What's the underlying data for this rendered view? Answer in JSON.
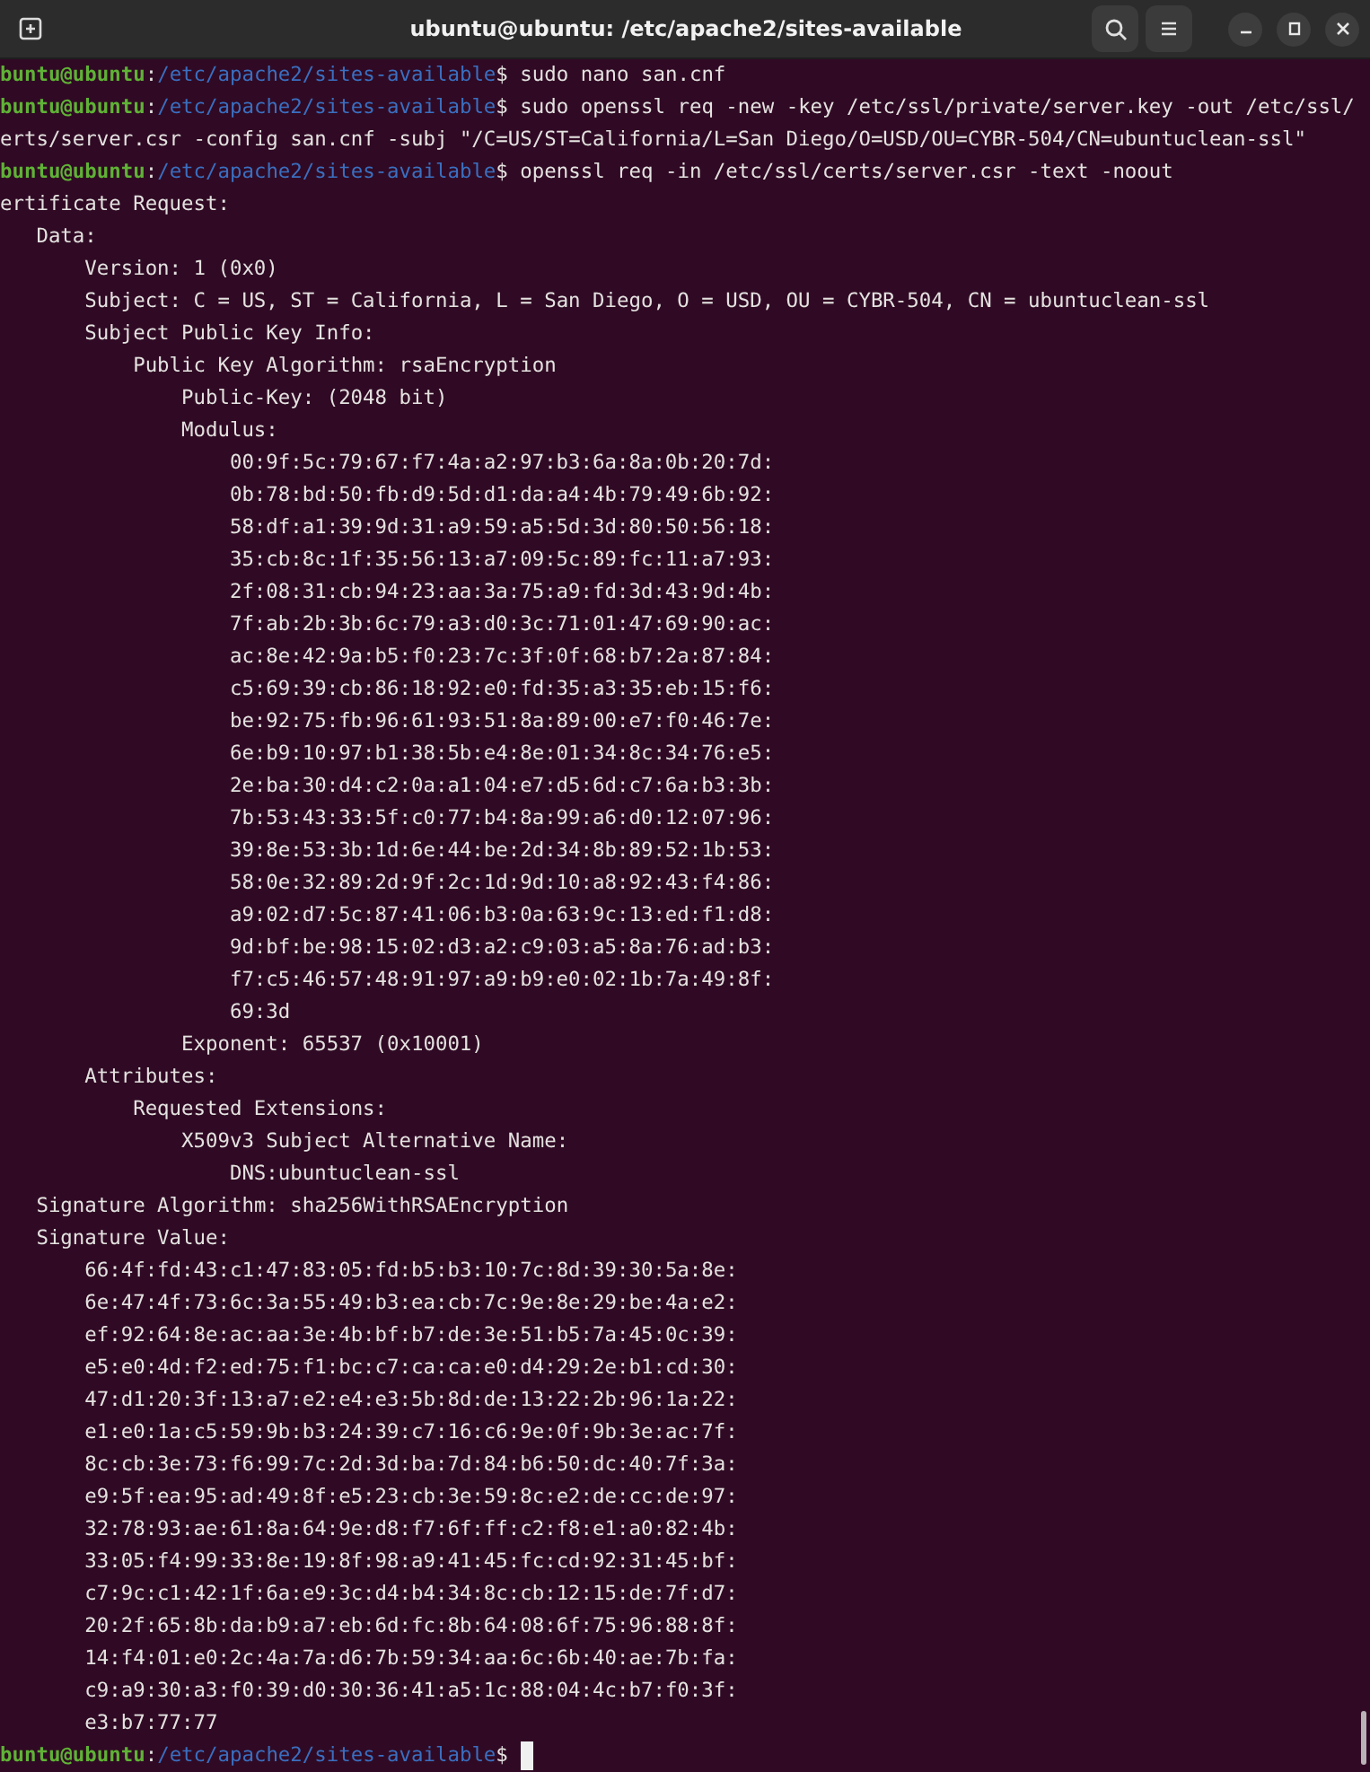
{
  "window": {
    "title": "ubuntu@ubuntu: /etc/apache2/sites-available"
  },
  "terminal": {
    "lines": [
      {
        "kind": "prompt",
        "user": "buntu@ubuntu",
        "separator": ":",
        "path": "/etc/apache2/sites-available",
        "symbol": "$",
        "command": "sudo nano san.cnf",
        "cursor": false
      },
      {
        "kind": "prompt",
        "user": "buntu@ubuntu",
        "separator": ":",
        "path": "/etc/apache2/sites-available",
        "symbol": "$",
        "command": "sudo openssl req -new -key /etc/ssl/private/server.key -out /etc/ssl/",
        "cursor": false
      },
      {
        "kind": "output",
        "text": "erts/server.csr -config san.cnf -subj \"/C=US/ST=California/L=San Diego/O=USD/OU=CYBR-504/CN=ubuntuclean-ssl\""
      },
      {
        "kind": "prompt",
        "user": "buntu@ubuntu",
        "separator": ":",
        "path": "/etc/apache2/sites-available",
        "symbol": "$",
        "command": "openssl req -in /etc/ssl/certs/server.csr -text -noout",
        "cursor": false
      },
      {
        "kind": "output",
        "text": "ertificate Request:",
        "children": [
          {
            "text": "Data:",
            "children": [
              {
                "text": "Version: 1 (0x0)"
              },
              {
                "text": "Subject: C = US, ST = California, L = San Diego, O = USD, OU = CYBR-504, CN = ubuntuclean-ssl"
              },
              {
                "text": "Subject Public Key Info:",
                "children": [
                  {
                    "text": "Public Key Algorithm: rsaEncryption",
                    "children": [
                      {
                        "text": "Public-Key: (2048 bit)"
                      },
                      {
                        "text": "Modulus:",
                        "children": [
                          {
                            "text": "00:9f:5c:79:67:f7:4a:a2:97:b3:6a:8a:0b:20:7d:"
                          },
                          {
                            "text": "0b:78:bd:50:fb:d9:5d:d1:da:a4:4b:79:49:6b:92:"
                          },
                          {
                            "text": "58:df:a1:39:9d:31:a9:59:a5:5d:3d:80:50:56:18:"
                          },
                          {
                            "text": "35:cb:8c:1f:35:56:13:a7:09:5c:89:fc:11:a7:93:"
                          },
                          {
                            "text": "2f:08:31:cb:94:23:aa:3a:75:a9:fd:3d:43:9d:4b:"
                          },
                          {
                            "text": "7f:ab:2b:3b:6c:79:a3:d0:3c:71:01:47:69:90:ac:"
                          },
                          {
                            "text": "ac:8e:42:9a:b5:f0:23:7c:3f:0f:68:b7:2a:87:84:"
                          },
                          {
                            "text": "c5:69:39:cb:86:18:92:e0:fd:35:a3:35:eb:15:f6:"
                          },
                          {
                            "text": "be:92:75:fb:96:61:93:51:8a:89:00:e7:f0:46:7e:"
                          },
                          {
                            "text": "6e:b9:10:97:b1:38:5b:e4:8e:01:34:8c:34:76:e5:"
                          },
                          {
                            "text": "2e:ba:30:d4:c2:0a:a1:04:e7:d5:6d:c7:6a:b3:3b:"
                          },
                          {
                            "text": "7b:53:43:33:5f:c0:77:b4:8a:99:a6:d0:12:07:96:"
                          },
                          {
                            "text": "39:8e:53:3b:1d:6e:44:be:2d:34:8b:89:52:1b:53:"
                          },
                          {
                            "text": "58:0e:32:89:2d:9f:2c:1d:9d:10:a8:92:43:f4:86:"
                          },
                          {
                            "text": "a9:02:d7:5c:87:41:06:b3:0a:63:9c:13:ed:f1:d8:"
                          },
                          {
                            "text": "9d:bf:be:98:15:02:d3:a2:c9:03:a5:8a:76:ad:b3:"
                          },
                          {
                            "text": "f7:c5:46:57:48:91:97:a9:b9:e0:02:1b:7a:49:8f:"
                          },
                          {
                            "text": "69:3d"
                          }
                        ]
                      },
                      {
                        "text": "Exponent: 65537 (0x10001)"
                      }
                    ]
                  }
                ]
              },
              {
                "text": "Attributes:",
                "children": [
                  {
                    "text": "Requested Extensions:",
                    "children": [
                      {
                        "text": "X509v3 Subject Alternative Name:",
                        "children": [
                          {
                            "text": "DNS:ubuntuclean-ssl"
                          }
                        ]
                      }
                    ]
                  }
                ]
              }
            ]
          },
          {
            "text": "Signature Algorithm: sha256WithRSAEncryption"
          },
          {
            "text": "Signature Value:",
            "children": [
              {
                "text": "66:4f:fd:43:c1:47:83:05:fd:b5:b3:10:7c:8d:39:30:5a:8e:"
              },
              {
                "text": "6e:47:4f:73:6c:3a:55:49:b3:ea:cb:7c:9e:8e:29:be:4a:e2:"
              },
              {
                "text": "ef:92:64:8e:ac:aa:3e:4b:bf:b7:de:3e:51:b5:7a:45:0c:39:"
              },
              {
                "text": "e5:e0:4d:f2:ed:75:f1:bc:c7:ca:ca:e0:d4:29:2e:b1:cd:30:"
              },
              {
                "text": "47:d1:20:3f:13:a7:e2:e4:e3:5b:8d:de:13:22:2b:96:1a:22:"
              },
              {
                "text": "e1:e0:1a:c5:59:9b:b3:24:39:c7:16:c6:9e:0f:9b:3e:ac:7f:"
              },
              {
                "text": "8c:cb:3e:73:f6:99:7c:2d:3d:ba:7d:84:b6:50:dc:40:7f:3a:"
              },
              {
                "text": "e9:5f:ea:95:ad:49:8f:e5:23:cb:3e:59:8c:e2:de:cc:de:97:"
              },
              {
                "text": "32:78:93:ae:61:8a:64:9e:d8:f7:6f:ff:c2:f8:e1:a0:82:4b:"
              },
              {
                "text": "33:05:f4:99:33:8e:19:8f:98:a9:41:45:fc:cd:92:31:45:bf:"
              },
              {
                "text": "c7:9c:c1:42:1f:6a:e9:3c:d4:b4:34:8c:cb:12:15:de:7f:d7:"
              },
              {
                "text": "20:2f:65:8b:da:b9:a7:eb:6d:fc:8b:64:08:6f:75:96:88:8f:"
              },
              {
                "text": "14:f4:01:e0:2c:4a:7a:d6:7b:59:34:aa:6c:6b:40:ae:7b:fa:"
              },
              {
                "text": "c9:a9:30:a3:f0:39:d0:30:36:41:a5:1c:88:04:4c:b7:f0:3f:"
              },
              {
                "text": "e3:b7:77:77"
              }
            ]
          }
        ]
      },
      {
        "kind": "prompt",
        "user": "buntu@ubuntu",
        "separator": ":",
        "path": "/etc/apache2/sites-available",
        "symbol": "$",
        "cursor": true
      }
    ]
  }
}
